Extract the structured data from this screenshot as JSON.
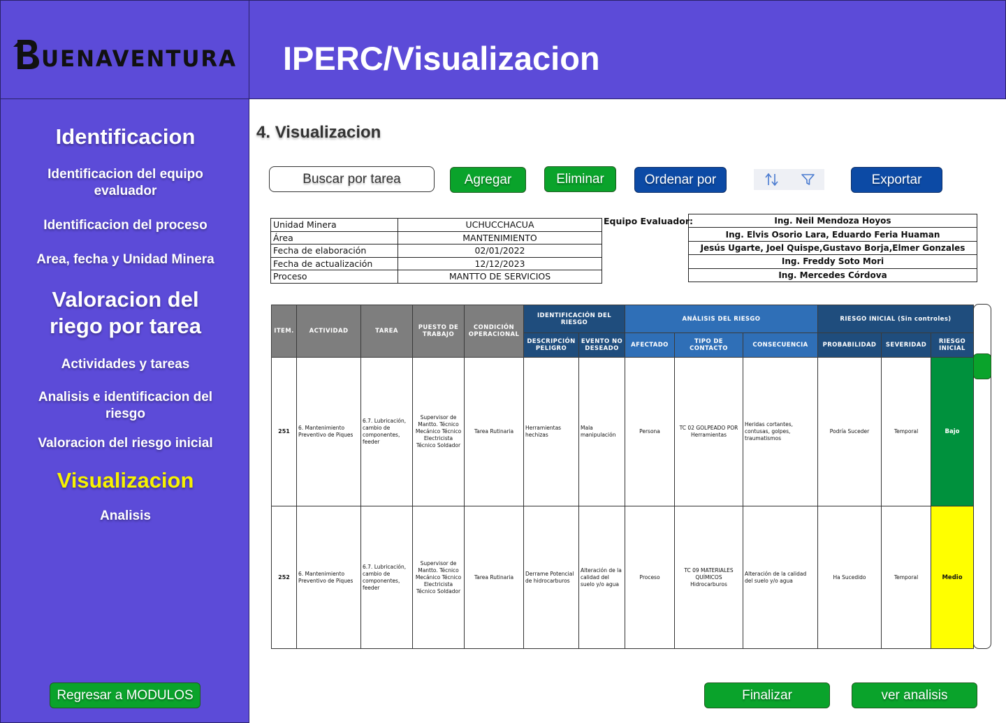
{
  "brand": {
    "logo_text": "BUENAVENTURA"
  },
  "header": {
    "title": "IPERC/Visualizacion"
  },
  "sidebar": {
    "items": [
      {
        "label": "Identificacion"
      },
      {
        "label": "Identificacion del equipo evaluador"
      },
      {
        "label": "Identificacion del proceso"
      },
      {
        "label": "Area, fecha y Unidad Minera"
      },
      {
        "label": "Valoracion del riego por tarea"
      },
      {
        "label": "Actividades y tareas"
      },
      {
        "label": "Analisis e identificacion del riesgo"
      },
      {
        "label": "Valoracion del riesgo inicial"
      },
      {
        "label": "Visualizacion"
      },
      {
        "label": "Analisis"
      }
    ],
    "back_button": "Regresar a MODULOS"
  },
  "main": {
    "section_number": "4.",
    "section_title": "Visualizacion",
    "toolbar": {
      "search_label": "Buscar por tarea",
      "add_label": "Agregar",
      "delete_label": "Eliminar",
      "sort_label": "Ordenar por",
      "export_label": "Exportar"
    },
    "info": [
      {
        "label": "Unidad Minera",
        "value": "UCHUCCHACUA"
      },
      {
        "label": "Área",
        "value": "MANTENIMIENTO"
      },
      {
        "label": "Fecha de elaboración",
        "value": "02/01/2022"
      },
      {
        "label": "Fecha de actualización",
        "value": "12/12/2023"
      },
      {
        "label": "Proceso",
        "value": "MANTTO DE SERVICIOS"
      }
    ],
    "team_label": "Equipo Evaluador:",
    "team": [
      "Ing. Neil Mendoza Hoyos",
      "Ing. Elvis Osorio Lara, Eduardo Feria Huaman",
      "Jesús Ugarte, Joel Quispe,Gustavo Borja,Elmer Gonzales",
      "Ing. Freddy Soto Mori",
      "Ing. Mercedes Córdova"
    ],
    "table": {
      "group_headers": {
        "identificacion": "IDENTIFICACIÓN DEL RIESGO",
        "analisis": "ANÁLISIS DEL RIESGO",
        "riesgo_inicial": "RIESGO INICIAL (Sin controles)"
      },
      "headers": {
        "item": "ITEM.",
        "actividad": "ACTIVIDAD",
        "tarea": "TAREA",
        "puesto": "PUESTO DE TRABAJO",
        "condicion": "CONDICIÓN OPERACIONAL",
        "descripcion": "DESCRIPCIÓN PELIGRO",
        "evento": "EVENTO NO DESEADO",
        "afectado": "AFECTADO",
        "tipo": "TIPO DE CONTACTO",
        "consecuencia": "CONSECUENCIA",
        "probabilidad": "PROBABILIDAD",
        "severidad": "SEVERIDAD",
        "riesgo": "RIESGO INICIAL"
      },
      "rows": [
        {
          "item": "251",
          "actividad": "6. Mantenimiento Preventivo de Piques",
          "tarea": "6.7. Lubricación, cambio de componentes, feeder",
          "puesto": "Supervisor de Mantto. Técnico Mecánico Técnico Electricista Técnico Soldador",
          "condicion": "Tarea Rutinaria",
          "descripcion": "Herramientas hechizas",
          "evento": "Mala manipulación",
          "afectado": "Persona",
          "tipo": "TC 02 GOLPEADO POR Herramientas",
          "consecuencia": "Heridas cortantes, contusas, golpes, traumatismos",
          "probabilidad": "Podría Suceder",
          "severidad": "Temporal",
          "riesgo": "Bajo",
          "riesgo_color": "#00913d"
        },
        {
          "item": "252",
          "actividad": "6. Mantenimiento Preventivo de Piques",
          "tarea": "6.7. Lubricación, cambio de componentes, feeder",
          "puesto": "Supervisor de Mantto. Técnico Mecánico Técnico Electricista Técnico Soldador",
          "condicion": "Tarea Rutinaria",
          "descripcion": "Derrame Potencial de hidrocarburos",
          "evento": "Alteración de la calidad del suelo y/o agua",
          "afectado": "Proceso",
          "tipo": "TC 09 MATERIALES QUÍMICOS Hidrocarburos",
          "consecuencia": "Alteración de la calidad del suelo y/o agua",
          "probabilidad": "Ha Sucedido",
          "severidad": "Temporal",
          "riesgo": "Medio",
          "riesgo_color": "#ffff00"
        }
      ]
    },
    "footer": {
      "finish_label": "Finalizar",
      "analysis_label": "ver analisis"
    },
    "icons": {
      "sort": "sort-arrows-icon",
      "filter": "filter-icon"
    },
    "colors": {
      "primary": "#5c4bd8",
      "green": "#0aa32b",
      "blue": "#0c4aa5",
      "active": "#f7f200"
    }
  }
}
